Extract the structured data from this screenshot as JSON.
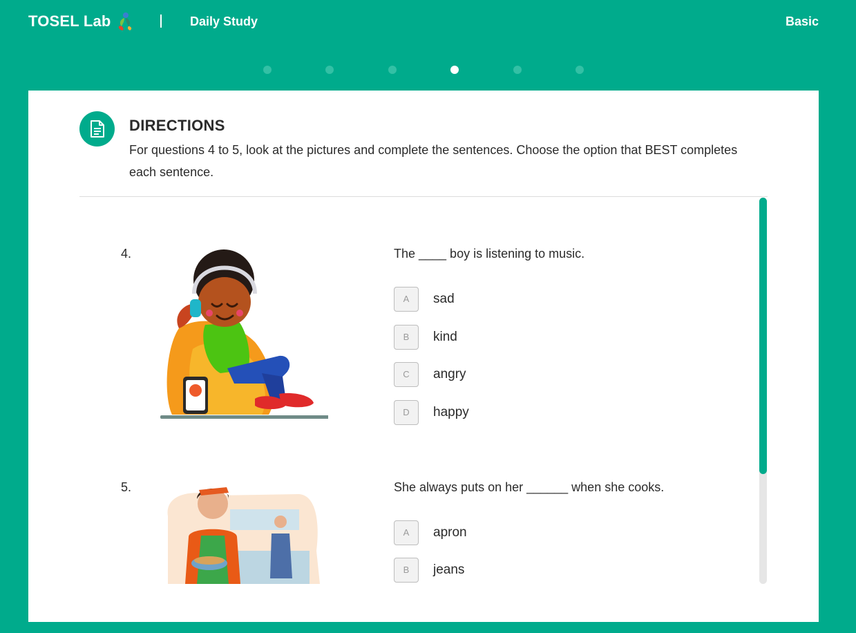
{
  "header": {
    "brand": "TOSEL Lab",
    "section": "Daily Study",
    "level": "Basic"
  },
  "progress": {
    "total": 6,
    "current_index": 3
  },
  "directions": {
    "title": "DIRECTIONS",
    "text": "For questions 4 to 5, look at the pictures and complete the sentences. Choose the option that BEST completes each sentence."
  },
  "questions": [
    {
      "number": "4.",
      "sentence": "The ____ boy is listening to music.",
      "image": "boy-with-headphones-illustration",
      "options": [
        {
          "letter": "A",
          "text": "sad"
        },
        {
          "letter": "B",
          "text": "kind"
        },
        {
          "letter": "C",
          "text": "angry"
        },
        {
          "letter": "D",
          "text": "happy"
        }
      ]
    },
    {
      "number": "5.",
      "sentence": "She always puts on her ______ when she cooks.",
      "image": "woman-cooking-illustration",
      "options": [
        {
          "letter": "A",
          "text": "apron"
        },
        {
          "letter": "B",
          "text": "jeans"
        }
      ]
    }
  ],
  "colors": {
    "brand": "#00ab8c",
    "dot_inactive": "#33c0a5",
    "dot_active": "#ffffff"
  }
}
